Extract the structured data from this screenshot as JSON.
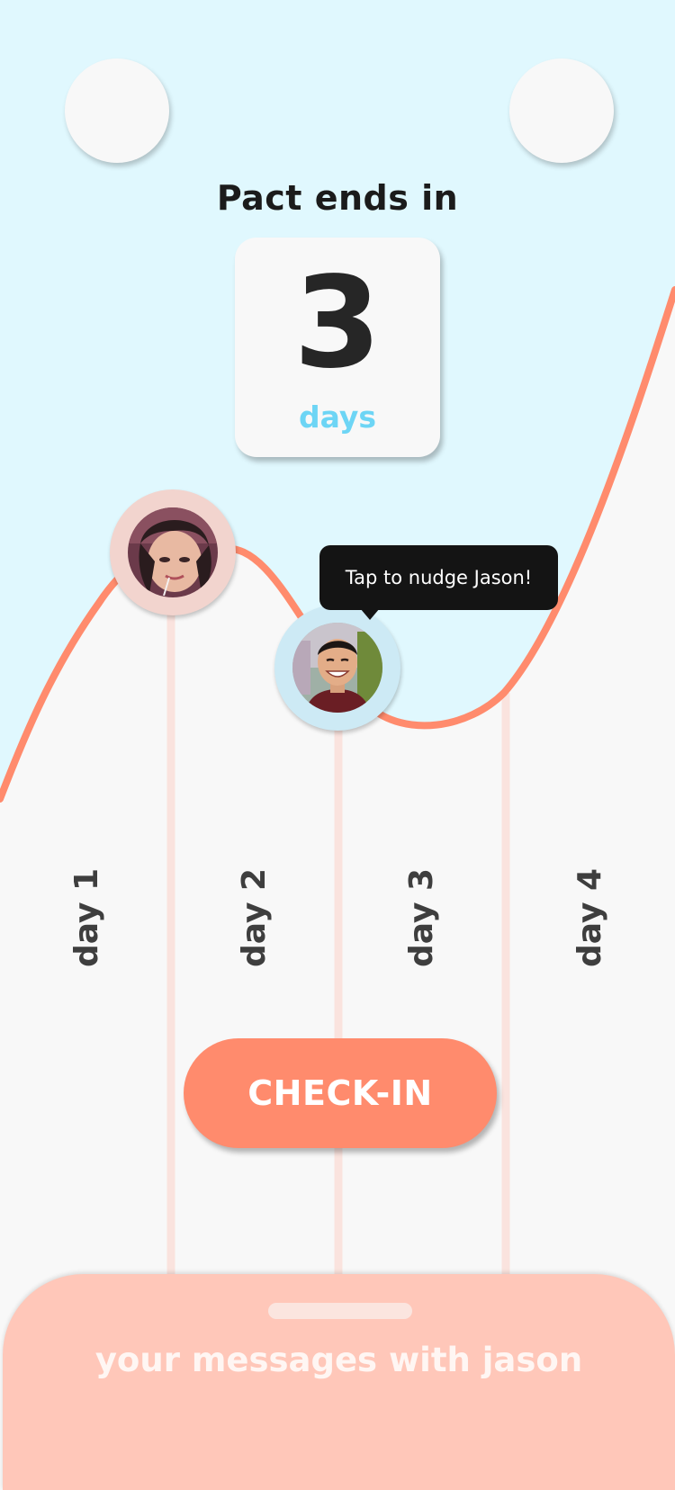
{
  "header": {
    "title": "Pact ends in",
    "countdown_value": "3",
    "countdown_unit": "days"
  },
  "tooltip": {
    "text": "Tap to nudge Jason!"
  },
  "days": [
    "day 1",
    "day 2",
    "day 3",
    "day 4"
  ],
  "actions": {
    "checkin_label": "CHECK-IN"
  },
  "messages_sheet": {
    "title": "your messages with jason"
  },
  "colors": {
    "sky": "#e0f8fe",
    "curve": "#ff8b6d",
    "accent_blue": "#6dd5f5",
    "button": "#ff8b6d",
    "sheet": "#ffc7b9"
  }
}
